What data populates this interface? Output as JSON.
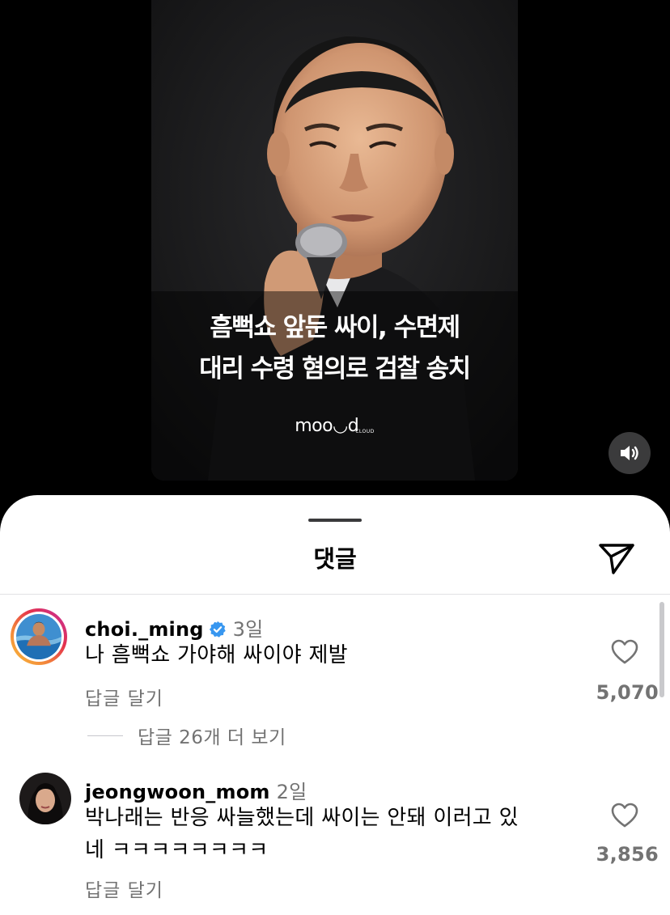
{
  "video": {
    "headline_line1": "흠뻑쇼 앞둔 싸이, 수면제",
    "headline_line2": "대리 수령 혐의로 검찰 송치",
    "logo": "moo◡d",
    "logo_sub": "CLOUD",
    "sound_icon": "speaker-wave-icon"
  },
  "sheet": {
    "title": "댓글",
    "share_icon": "paper-plane-icon"
  },
  "comments": [
    {
      "username": "choi._ming",
      "verified": true,
      "time": "3일",
      "text": "나 흠뻑쇼 가야해 싸이야 제발",
      "reply_label": "답글 달기",
      "likes": "5,070",
      "view_replies": "답글 26개 더 보기"
    },
    {
      "username": "jeongwoon_mom",
      "verified": false,
      "time": "2일",
      "text_line1": "박나래는 반응 싸늘했는데 싸이는 안돼 이러고 있",
      "text_line2": "네 ㅋㅋㅋㅋㅋㅋㅋㅋ",
      "reply_label": "답글 달기",
      "likes": "3,856"
    }
  ],
  "colors": {
    "background": "#000000",
    "sheet": "#ffffff",
    "secondary_text": "#737373",
    "verified_blue": "#3897f0"
  }
}
